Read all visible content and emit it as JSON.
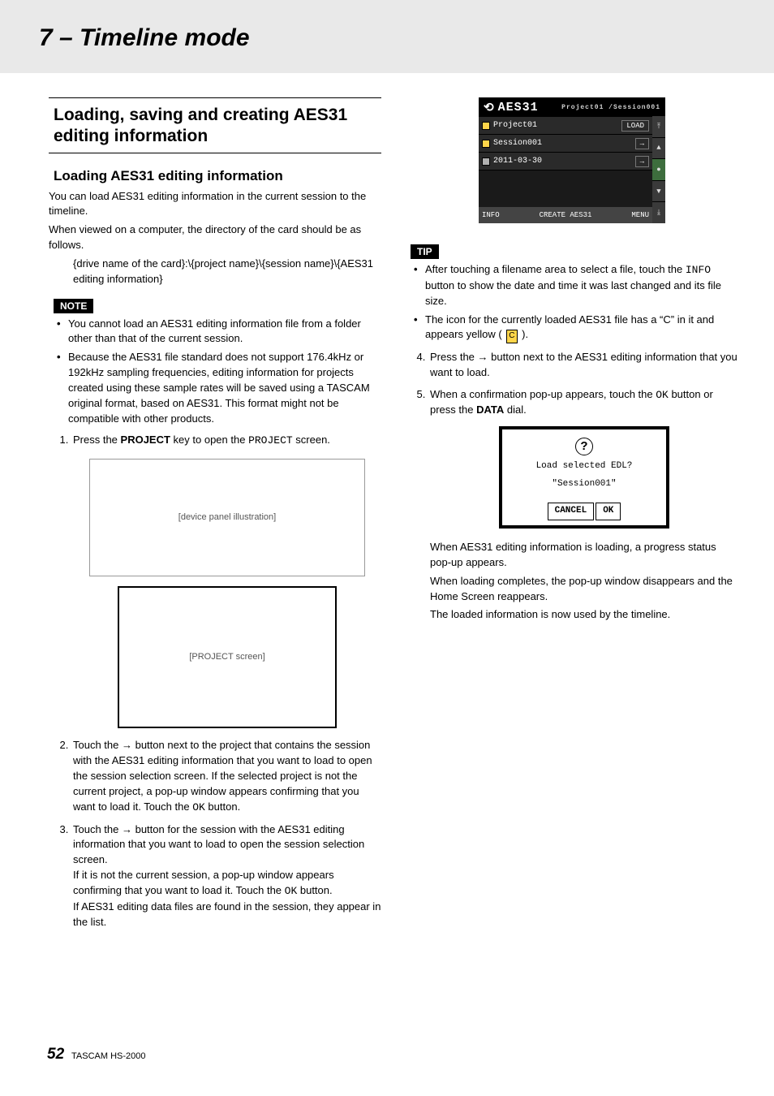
{
  "chapter": "7 – Timeline mode",
  "section_title": "Loading, saving and creating AES31 editing information",
  "subsection_title": "Loading AES31 editing information",
  "intro1": "You can load AES31 editing information in the current session to the timeline.",
  "intro2": "When viewed on a computer, the directory of the card should be as follows.",
  "path_format": "{drive name of the card}:\\{project name}\\{session name}\\{AES31 editing information}",
  "note_label": "NOTE",
  "notes": [
    "You cannot load an AES31 editing information file from a folder other than that of the current session.",
    "Because the AES31 file standard does not support 176.4kHz or 192kHz sampling frequencies, editing information for projects created using these sample rates will be saved using a TASCAM original format, based on AES31. This format might not be compatible with other products."
  ],
  "step1_pre": "Press the ",
  "step1_bold": "PROJECT",
  "step1_mid": " key to open the ",
  "step1_mono": "PROJECT",
  "step1_post": " screen.",
  "step2": "Touch the → button next to the project that contains the session with the AES31 editing information that you want to load to open the session selection screen. If the selected project is not the current project, a pop-up window appears confirming that you want to load it. Touch the ",
  "step2_ok": "OK",
  "step2_post": " button.",
  "step3a": "Touch the → button for the session with the AES31 editing information that you want to load to open the session selection screen.",
  "step3b_pre": "If it is not the current session, a pop-up window appears confirming that you want to load it. Touch the ",
  "step3b_ok": "OK",
  "step3b_post": " button.",
  "step3c": "If AES31 editing data files are found in the session, they appear in the list.",
  "aes31": {
    "title": "AES31",
    "breadcrumb": "Project01 /Session001",
    "row1_label": "Project01",
    "row1_btn": "LOAD",
    "row2_label": "Session001",
    "row3_label": "2011-03-30",
    "footer_left": "INFO",
    "footer_mid": "CREATE AES31",
    "footer_right": "MENU"
  },
  "tip_label": "TIP",
  "tips_1_pre": "After touching a filename area to select a file, touch the ",
  "tips_1_mono": "INFO",
  "tips_1_post": " button to show the date and time it was last changed and its file size.",
  "tips_2_pre": "The icon for the currently loaded AES31 file has a “C” in it and appears yellow ( ",
  "tips_2_chip": "C",
  "tips_2_post": " ).",
  "step4": "Press the → button next to the AES31 editing information that you want to load.",
  "step5_pre": "When a confirmation pop-up appears, touch the ",
  "step5_ok": "OK",
  "step5_mid": " button or press the ",
  "step5_bold": "DATA",
  "step5_post": " dial.",
  "popup": {
    "line1": "Load selected EDL?",
    "line2": "\"Session001\"",
    "cancel": "CANCEL",
    "ok": "OK"
  },
  "closing1": "When AES31 editing information is loading, a progress status pop-up appears.",
  "closing2": "When loading completes, the pop-up window disappears and the Home Screen reappears.",
  "closing3": "The loaded information is now used by the timeline.",
  "footer_page": "52",
  "footer_model": "TASCAM  HS-2000",
  "placeholders": {
    "device": "[device panel illustration]",
    "project_screen": "[PROJECT screen]"
  }
}
